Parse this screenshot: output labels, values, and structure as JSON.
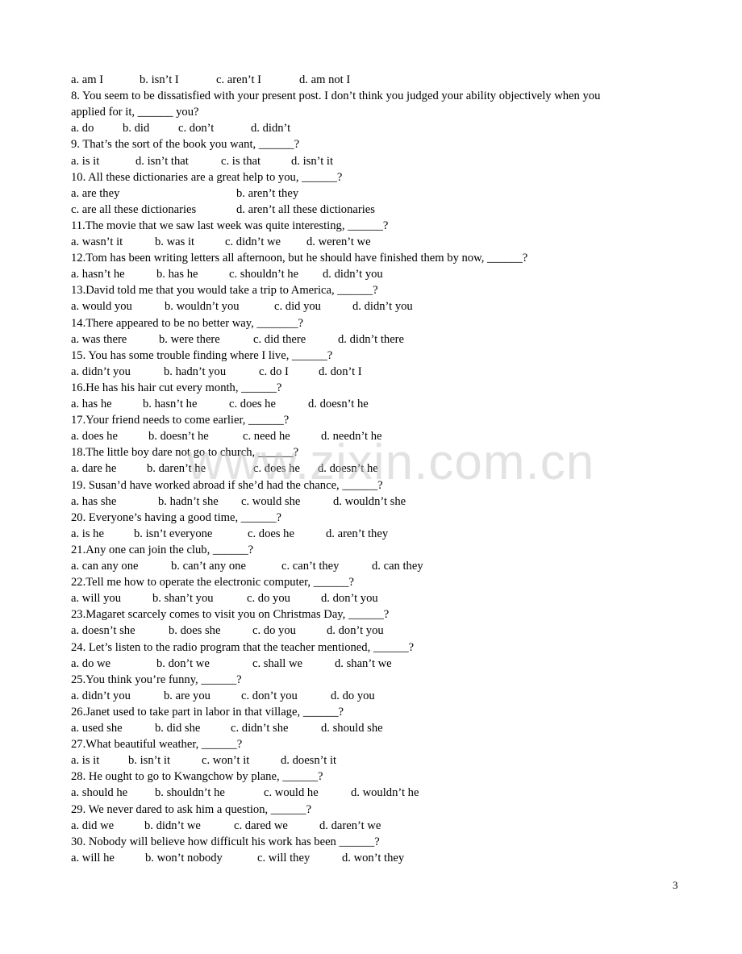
{
  "watermark": "www.zixin.com.cn",
  "page_number": "3",
  "lines": [
    {
      "kind": "options",
      "opts": [
        "a. am I",
        "b. isn’t I",
        "c. aren’t I",
        "d. am not I"
      ]
    },
    {
      "kind": "question",
      "text": "8.    You seem to be dissatisfied with your present post. I don’t think you judged your ability objectively when you"
    },
    {
      "kind": "question",
      "text": "applied for it, ______ you?"
    },
    {
      "kind": "options",
      "opts": [
        "a. do",
        "b. did",
        "c. don’t",
        "d. didn’t"
      ]
    },
    {
      "kind": "question",
      "text": "9.    That’s the sort of the book you want, ______?"
    },
    {
      "kind": "options",
      "opts": [
        "a. is it",
        "d. isn’t that",
        "c. is that",
        "d. isn’t it"
      ]
    },
    {
      "kind": "question",
      "text": "10. All these dictionaries are a great help to you, ______?"
    },
    {
      "kind": "options",
      "opts": [
        "a. are they",
        "b. aren’t they"
      ]
    },
    {
      "kind": "options",
      "opts": [
        "c. are all these dictionaries",
        "d. aren’t all these dictionaries"
      ]
    },
    {
      "kind": "question",
      "text": "11.The movie that we saw last week was quite interesting, ______?"
    },
    {
      "kind": "options",
      "opts": [
        "a. wasn’t it",
        "b. was it",
        "c. didn’t we",
        "d. weren’t we"
      ]
    },
    {
      "kind": "question",
      "text": "12.Tom has been writing letters all afternoon, but he should have finished them by now,     ______?"
    },
    {
      "kind": "options",
      "opts": [
        "a. hasn’t he",
        "b. has he",
        "c. shouldn’t he",
        "d. didn’t you"
      ]
    },
    {
      "kind": "question",
      "text": "13.David told me that you would take a trip to America, ______?"
    },
    {
      "kind": "options",
      "opts": [
        "a. would you",
        "b. wouldn’t you",
        "c. did you",
        "d. didn’t you"
      ]
    },
    {
      "kind": "question",
      "text": "14.There appeared to be no better way, _______?"
    },
    {
      "kind": "options",
      "opts": [
        "a. was there",
        "b. were there",
        "c. did there",
        "d. didn’t there"
      ]
    },
    {
      "kind": "question",
      "text": "15. You has some trouble finding where I live, ______?"
    },
    {
      "kind": "options",
      "opts": [
        "a. didn’t you",
        "b. hadn’t you",
        "c. do I",
        "d. don’t I"
      ]
    },
    {
      "kind": "question",
      "text": "16.He has his hair cut every month, ______?"
    },
    {
      "kind": "options",
      "opts": [
        "a. has he",
        "b. hasn’t he",
        "c. does he",
        "d. doesn’t he"
      ]
    },
    {
      "kind": "question",
      "text": "17.Your friend needs to come earlier, ______?"
    },
    {
      "kind": "options",
      "opts": [
        "a. does he",
        "b. doesn’t he",
        "c. need he",
        "d. needn’t he"
      ]
    },
    {
      "kind": "question",
      "text": "18.The little boy dare not go to church, ______?"
    },
    {
      "kind": "options",
      "opts": [
        "a. dare he",
        "b. daren’t he",
        "c. does he",
        "d. doesn’t he"
      ]
    },
    {
      "kind": "question",
      "text": "19. Susan’d have worked abroad if she’d had the chance, ______?"
    },
    {
      "kind": "options",
      "opts": [
        "a. has she",
        "b. hadn’t she",
        "c. would she",
        "d. wouldn’t she"
      ]
    },
    {
      "kind": "question",
      "text": "20. Everyone’s having a good time, ______?"
    },
    {
      "kind": "options",
      "opts": [
        "a. is he",
        "b. isn’t everyone",
        "c. does he",
        "d. aren’t they"
      ]
    },
    {
      "kind": "question",
      "text": "21.Any one can join the club, ______?"
    },
    {
      "kind": "options",
      "opts": [
        "a. can any one",
        "b. can’t any one",
        "c. can’t they",
        "d. can they"
      ]
    },
    {
      "kind": "question",
      "text": "22.Tell me how to operate the electronic computer, ______?"
    },
    {
      "kind": "options",
      "opts": [
        "a. will you",
        "b. shan’t you",
        "c. do you",
        "d. don’t you"
      ]
    },
    {
      "kind": "question",
      "text": "23.Magaret scarcely comes to visit you on Christmas Day, ______?"
    },
    {
      "kind": "options",
      "opts": [
        "a. doesn’t she",
        "b. does she",
        "c. do you",
        "d. don’t you"
      ]
    },
    {
      "kind": "question",
      "text": "24. Let’s listen to the radio program that the teacher mentioned, ______?"
    },
    {
      "kind": "options",
      "opts": [
        "a. do we",
        "b. don’t we",
        "c. shall we",
        "d. shan’t we"
      ]
    },
    {
      "kind": "question",
      "text": "25.You think you’re funny, ______?"
    },
    {
      "kind": "options",
      "opts": [
        "a. didn’t you",
        "b. are you",
        "c. don’t you",
        "d. do you"
      ]
    },
    {
      "kind": "question",
      "text": "26.Janet used to take part in labor in that village, ______?"
    },
    {
      "kind": "options",
      "opts": [
        "a. used she",
        "b. did she",
        "c. didn’t she",
        "d. should she"
      ]
    },
    {
      "kind": "question",
      "text": "27.What beautiful weather, ______?"
    },
    {
      "kind": "options",
      "opts": [
        "a. is it",
        "b. isn’t it",
        "c. won’t it",
        "d. doesn’t it"
      ]
    },
    {
      "kind": "question",
      "text": "28. He ought to go to Kwangchow by plane, ______?"
    },
    {
      "kind": "options",
      "opts": [
        "a. should he",
        "b. shouldn’t he",
        "c. would he",
        "d. wouldn’t he"
      ]
    },
    {
      "kind": "question",
      "text": "29. We never dared to ask him a question, ______?"
    },
    {
      "kind": "options",
      "opts": [
        "a. did we",
        "b. didn’t we",
        "c. dared we",
        "d. daren’t we"
      ]
    },
    {
      "kind": "question",
      "text": "30.          Nobody will believe how difficult his work has been ______?"
    },
    {
      "kind": "options",
      "opts": [
        "a. will he",
        "b. won’t nobody",
        "c. will they",
        "d. won’t they"
      ]
    }
  ]
}
